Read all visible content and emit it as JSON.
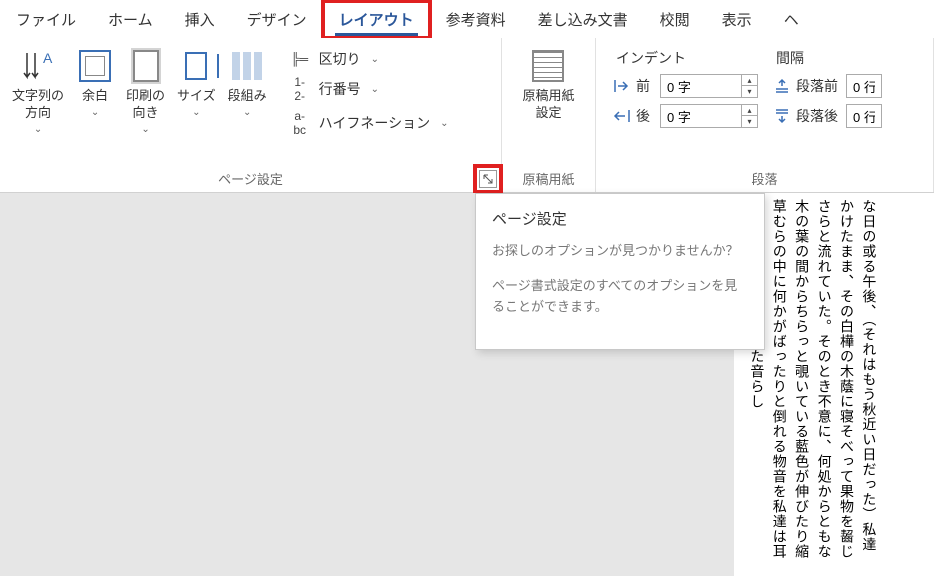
{
  "tabs": {
    "file": "ファイル",
    "home": "ホーム",
    "insert": "挿入",
    "design": "デザイン",
    "layout": "レイアウト",
    "references": "参考資料",
    "mailings": "差し込み文書",
    "review": "校閲",
    "view": "表示",
    "more": "ヘ"
  },
  "page_setup": {
    "text_direction": "文字列の\n方向",
    "margins": "余白",
    "orientation": "印刷の\n向き",
    "size": "サイズ",
    "columns": "段組み",
    "breaks": "区切り",
    "line_numbers": "行番号",
    "hyphenation": "ハイフネーション",
    "group_label": "ページ設定"
  },
  "manuscript": {
    "button": "原稿用紙\n設定",
    "group_label": "原稿用紙"
  },
  "paragraph": {
    "indent_label": "インデント",
    "spacing_label": "間隔",
    "before_label": "前",
    "after_label": "後",
    "space_before_label": "段落前",
    "space_after_label": "段落後",
    "indent_before": "0 字",
    "indent_after": "0 字",
    "space_before": "0 行",
    "space_after": "0 行",
    "group_label": "段落"
  },
  "tooltip": {
    "title": "ページ設定",
    "line1": "お探しのオプションが見つかりませんか？",
    "line2": "ページ書式設定のすべてのオプションを見ることができます。"
  },
  "document": {
    "col1": "な日の或る午後、（それはもう秋近い日だった）私達",
    "col2": "かけたまま、その白樺の木蔭に寝そべって果物を齧じ",
    "col3": "さらと流れていた。そのとき不意に、何処からともな",
    "col4": "木の葉の間からちらっと覗いている藍色が伸びたり縮",
    "col5": "草むらの中に何かがばったりと倒れる物音を私達は耳",
    "col6": "が、画架と共に、倒れた音らし"
  }
}
